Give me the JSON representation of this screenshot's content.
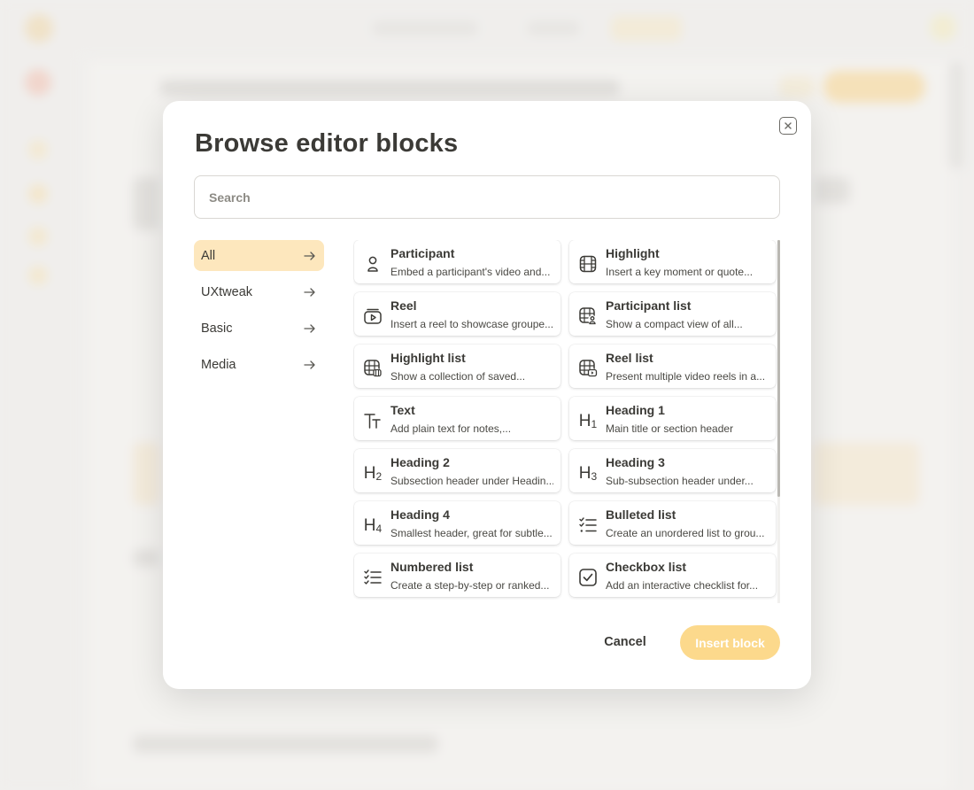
{
  "modal": {
    "title": "Browse editor blocks",
    "search_placeholder": "Search",
    "cancel_label": "Cancel",
    "insert_label": "Insert block"
  },
  "categories": [
    {
      "label": "All",
      "active": true
    },
    {
      "label": "UXtweak",
      "active": false
    },
    {
      "label": "Basic",
      "active": false
    },
    {
      "label": "Media",
      "active": false
    }
  ],
  "blocks": [
    {
      "title": "Participant",
      "desc": "Embed a participant's video and...",
      "icon": "participant-icon"
    },
    {
      "title": "Highlight",
      "desc": "Insert a key moment or quote...",
      "icon": "film-icon"
    },
    {
      "title": "Reel",
      "desc": "Insert a reel to showcase groupe...",
      "icon": "reel-icon"
    },
    {
      "title": "Participant list",
      "desc": "Show a compact view of all...",
      "icon": "participant-list-icon"
    },
    {
      "title": "Highlight list",
      "desc": "Show a collection of saved...",
      "icon": "highlight-list-icon"
    },
    {
      "title": "Reel list",
      "desc": "Present multiple video reels in a...",
      "icon": "reel-list-icon"
    },
    {
      "title": "Text",
      "desc": "Add plain text for notes,...",
      "icon": "text-icon"
    },
    {
      "title": "Heading 1",
      "desc": "Main title or section header",
      "icon": "heading-1-icon"
    },
    {
      "title": "Heading 2",
      "desc": "Subsection header under Headin...",
      "icon": "heading-2-icon"
    },
    {
      "title": "Heading 3",
      "desc": "Sub-subsection header under...",
      "icon": "heading-3-icon"
    },
    {
      "title": "Heading 4",
      "desc": "Smallest header, great for subtle...",
      "icon": "heading-4-icon"
    },
    {
      "title": "Bulleted list",
      "desc": "Create an unordered list to grou...",
      "icon": "bulleted-list-icon"
    },
    {
      "title": "Numbered list",
      "desc": "Create a step-by-step or ranked...",
      "icon": "numbered-list-icon"
    },
    {
      "title": "Checkbox list",
      "desc": "Add an interactive checklist for...",
      "icon": "checkbox-list-icon"
    }
  ],
  "colors": {
    "accent": "#fcd98c",
    "active_category_bg": "#fde7bd",
    "text": "#3b3a36"
  }
}
